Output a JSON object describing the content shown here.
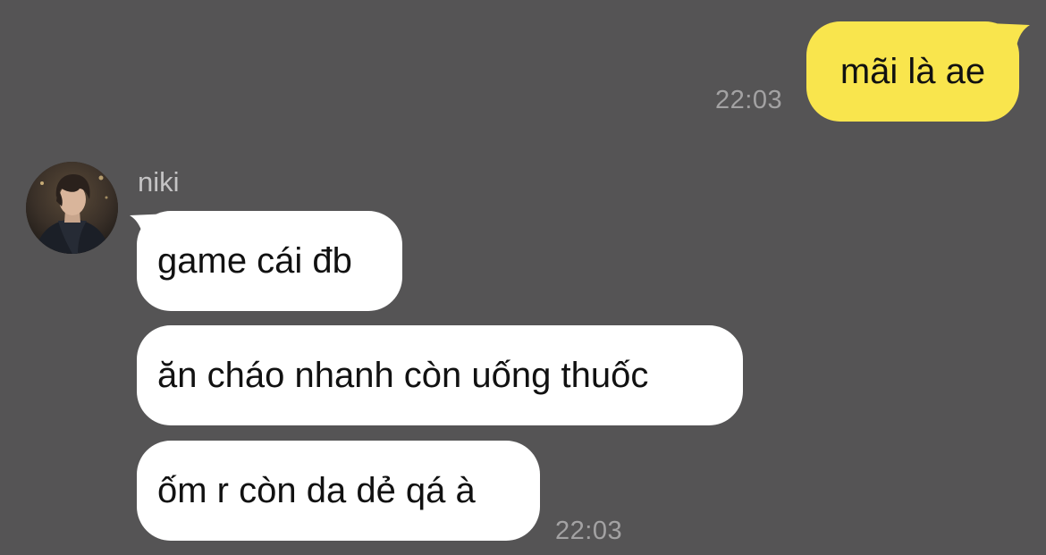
{
  "conversation": {
    "outgoing": [
      {
        "text": "mãi là ae",
        "time": "22:03"
      }
    ],
    "incoming": {
      "sender_name": "niki",
      "avatar_icon": "user-photo-avatar",
      "messages": [
        {
          "text": "game cái đb"
        },
        {
          "text": "ăn cháo nhanh còn uống thuốc"
        },
        {
          "text": "ốm r còn da dẻ qá à"
        }
      ],
      "time": "22:03"
    }
  },
  "colors": {
    "background": "#555455",
    "outgoing_bubble": "#f9e54d",
    "incoming_bubble": "#ffffff",
    "timestamp": "#a3a2a3",
    "sender_name": "#c4c3c4"
  }
}
